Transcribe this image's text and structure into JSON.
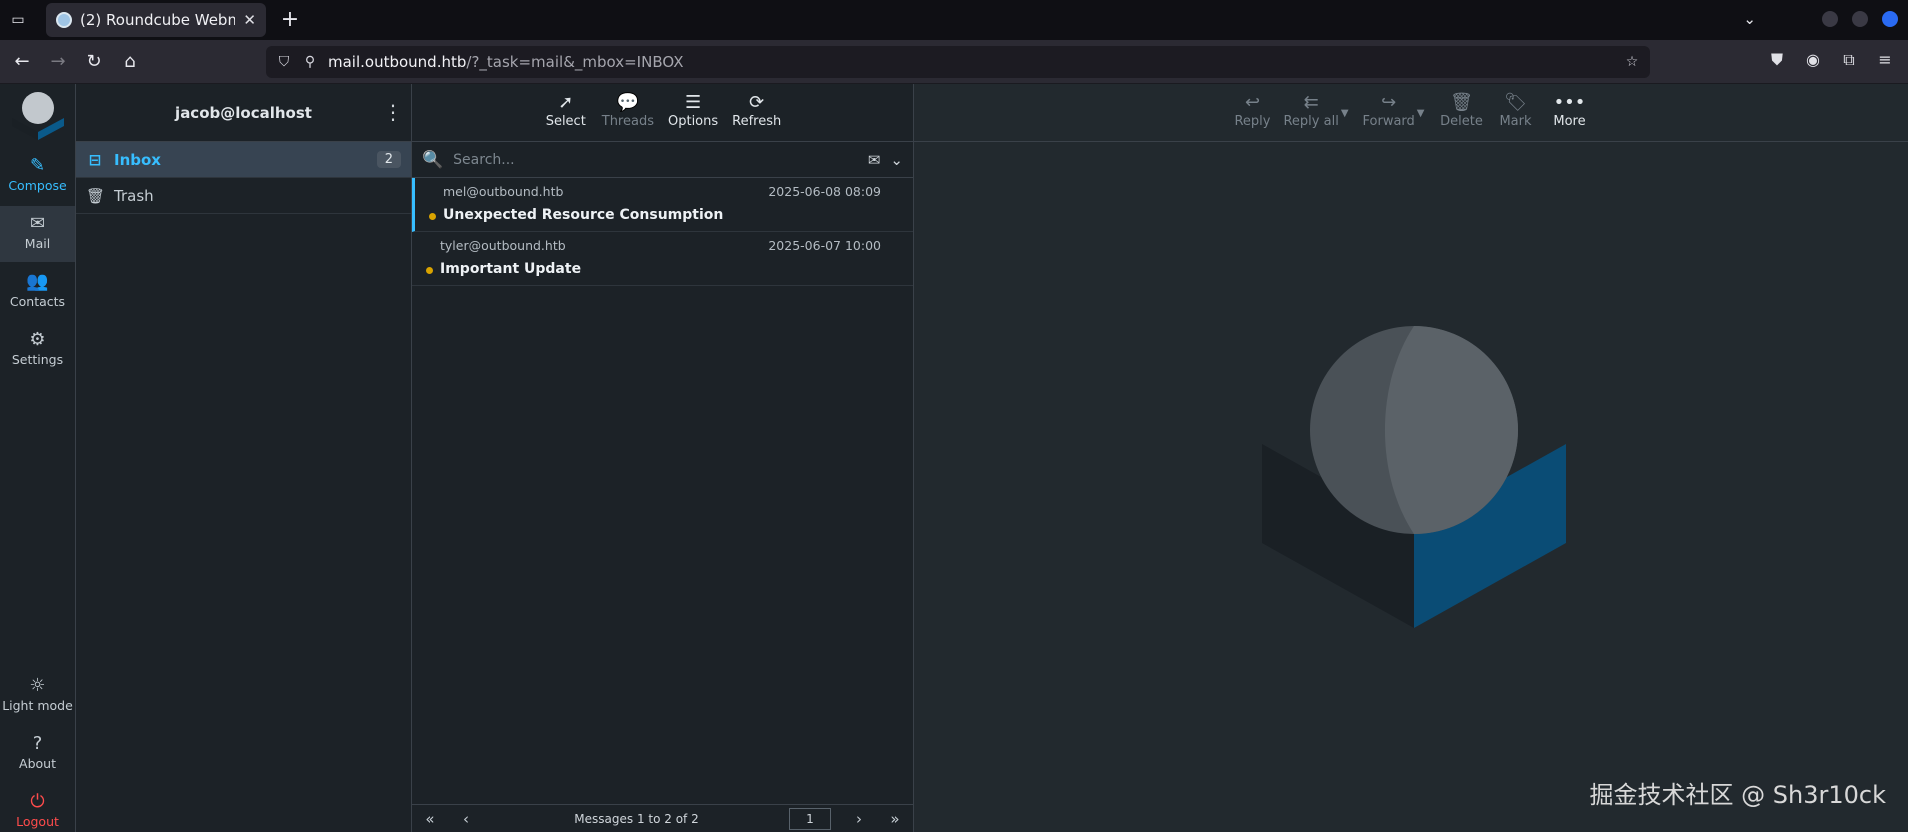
{
  "browser": {
    "tab_title": "(2) Roundcube Webmail :: Inbox",
    "tab_list_icon": "tab-list-icon",
    "url_host": "mail.outbound.htb",
    "url_path": "/?_task=mail&_mbox=INBOX"
  },
  "menu": {
    "compose": "Compose",
    "mail": "Mail",
    "contacts": "Contacts",
    "settings": "Settings",
    "light_mode": "Light mode",
    "about": "About",
    "logout": "Logout"
  },
  "sidebar": {
    "account": "jacob@localhost",
    "folders": [
      {
        "label": "Inbox",
        "count": "2"
      },
      {
        "label": "Trash",
        "count": ""
      }
    ]
  },
  "list_toolbar": {
    "select": "Select",
    "threads": "Threads",
    "options": "Options",
    "refresh": "Refresh"
  },
  "search": {
    "placeholder": "Search..."
  },
  "messages": [
    {
      "from": "mel@outbound.htb",
      "date": "2025-06-08 08:09",
      "subject": "Unexpected Resource Consumption"
    },
    {
      "from": "tyler@outbound.htb",
      "date": "2025-06-07 10:00",
      "subject": "Important Update"
    }
  ],
  "pagination": {
    "info": "Messages 1 to 2 of 2",
    "page": "1"
  },
  "content_toolbar": {
    "reply": "Reply",
    "reply_all": "Reply all",
    "forward": "Forward",
    "delete": "Delete",
    "mark": "Mark",
    "more": "More"
  },
  "credit": "掘金技术社区 @ Sh3r10ck",
  "colors": {
    "accent": "#37beff",
    "unread_dot": "#d9a300",
    "logout": "#ff4c4c"
  }
}
